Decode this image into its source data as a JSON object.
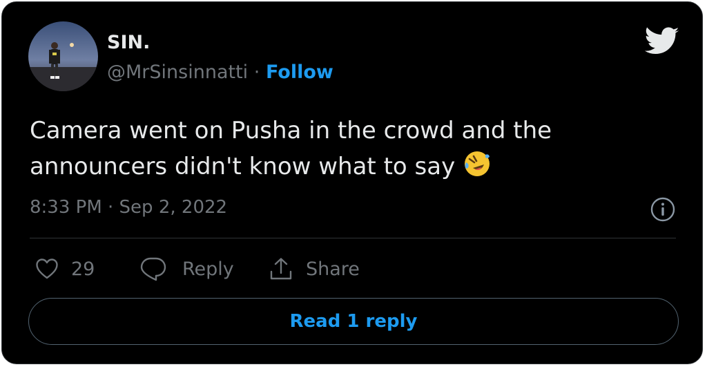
{
  "user": {
    "display_name": "SIN.",
    "handle": "@MrSinsinnatti",
    "separator": "·",
    "follow_label": "Follow"
  },
  "tweet": {
    "text": "Camera went on Pusha in the crowd and the announcers didn't know what to say",
    "emoji": "rolling-on-the-floor-laughing",
    "timestamp": "8:33 PM · Sep 2, 2022"
  },
  "actions": {
    "like_count": "29",
    "reply_label": "Reply",
    "share_label": "Share"
  },
  "read_replies_label": "Read 1 reply",
  "icons": {
    "logo": "twitter-bird-icon",
    "info": "info-icon",
    "like": "heart-icon",
    "reply": "reply-bubble-icon",
    "share": "share-upload-icon"
  },
  "colors": {
    "background": "#000000",
    "text": "#e7e9ea",
    "secondary_text": "#71767b",
    "accent": "#1d9bf0",
    "border": "#2f3336"
  }
}
